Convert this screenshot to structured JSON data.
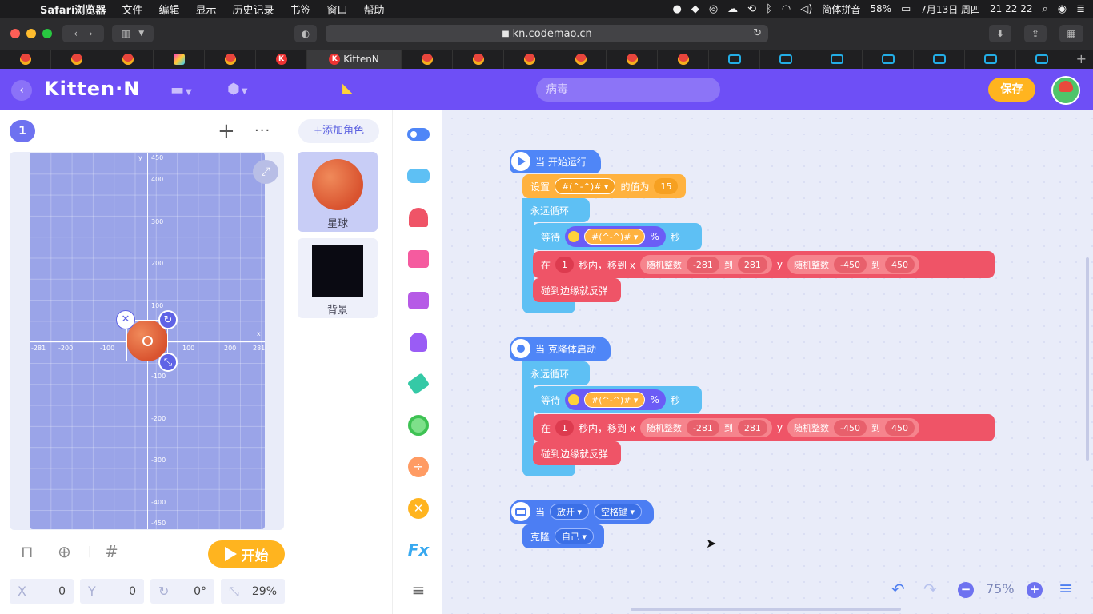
{
  "menubar": {
    "items": [
      "Safari浏览器",
      "文件",
      "编辑",
      "显示",
      "历史记录",
      "书签",
      "窗口",
      "帮助"
    ],
    "input_method": "简体拼音",
    "battery": "58%",
    "date": "7月13日 周四",
    "time": "21 22 22"
  },
  "browser": {
    "url": "kn.codemao.cn",
    "active_tab": "KittenN"
  },
  "app": {
    "logo": "Kitten·N",
    "search_value": "病毒",
    "save_label": "保存"
  },
  "stage": {
    "scene_number": "1",
    "axis": {
      "x_ticks": [
        "-281",
        "-200",
        "-100",
        "0",
        "100",
        "200",
        "281"
      ],
      "y_ticks": [
        "450",
        "400",
        "300",
        "200",
        "100",
        "-100",
        "-200",
        "-300",
        "-400",
        "-450"
      ],
      "x_label": "x",
      "y_label": "y"
    },
    "start_label": "开始",
    "props": {
      "x_label": "X",
      "x_value": "0",
      "y_label": "Y",
      "y_value": "0",
      "rotation": "0°",
      "scale": "29%"
    }
  },
  "sprites": {
    "add_label": "添加角色",
    "items": [
      {
        "name": "星球",
        "selected": true
      },
      {
        "name": "背景",
        "selected": false
      }
    ]
  },
  "categories": [
    "toggle",
    "gamepad",
    "ghost",
    "shirt",
    "chat",
    "bulb",
    "pen",
    "circle",
    "divide",
    "close",
    "fx",
    "menu"
  ],
  "scripts": {
    "s1": {
      "hat": "当 开始运行",
      "set_a": "设置",
      "set_var": "#(^-^)#",
      "set_b": "的值为",
      "set_val": "15",
      "forever": "永远循环",
      "wait": "等待",
      "wait_var": "#(^-^)#",
      "percent": "%",
      "sec": "秒",
      "move_in": "在",
      "move_secs": "1",
      "move_to": "秒内，移到 x",
      "rand": "随机整数",
      "x_min": "-281",
      "to": "到",
      "x_max": "281",
      "y": "y",
      "y_min": "-450",
      "y_max": "450",
      "bounce": "碰到边缘就反弹"
    },
    "s2": {
      "hat": "当 克隆体启动",
      "forever": "永远循环",
      "wait": "等待",
      "wait_var": "#(^-^)#",
      "percent": "%",
      "sec": "秒",
      "move_in": "在",
      "move_secs": "1",
      "move_to": "秒内，移到 x",
      "rand": "随机整数",
      "x_min": "-281",
      "to": "到",
      "x_max": "281",
      "y": "y",
      "y_min": "-450",
      "y_max": "450",
      "bounce": "碰到边缘就反弹"
    },
    "s3": {
      "when": "当",
      "action": "放开",
      "key": "空格键",
      "clone": "克隆",
      "target": "自己"
    }
  },
  "zoom": "75%"
}
